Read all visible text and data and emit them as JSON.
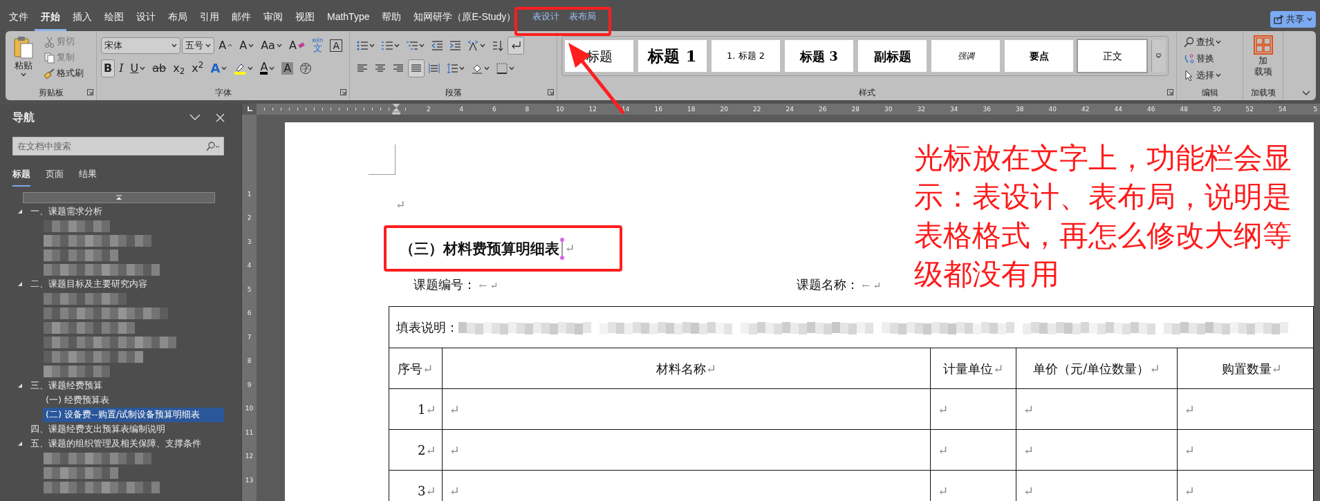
{
  "menu_tabs": [
    {
      "label": "文件",
      "kind": "main",
      "selected": false
    },
    {
      "label": "开始",
      "kind": "main",
      "selected": true
    },
    {
      "label": "插入",
      "kind": "main",
      "selected": false
    },
    {
      "label": "绘图",
      "kind": "main",
      "selected": false
    },
    {
      "label": "设计",
      "kind": "main",
      "selected": false
    },
    {
      "label": "布局",
      "kind": "main",
      "selected": false
    },
    {
      "label": "引用",
      "kind": "main",
      "selected": false
    },
    {
      "label": "邮件",
      "kind": "main",
      "selected": false
    },
    {
      "label": "审阅",
      "kind": "main",
      "selected": false
    },
    {
      "label": "视图",
      "kind": "main",
      "selected": false
    },
    {
      "label": "MathType",
      "kind": "main",
      "selected": false
    },
    {
      "label": "帮助",
      "kind": "main",
      "selected": false
    },
    {
      "label": "知网研学（原E-Study）",
      "kind": "main",
      "selected": false
    },
    {
      "label": "表设计",
      "kind": "context",
      "selected": false
    },
    {
      "label": "表布局",
      "kind": "context",
      "selected": false
    }
  ],
  "share_button": {
    "label": "共享"
  },
  "clipboard": {
    "title": "剪贴板",
    "paste": "粘贴",
    "items": [
      {
        "label": "剪切",
        "disabled": true
      },
      {
        "label": "复制",
        "disabled": true
      },
      {
        "label": "格式刷",
        "disabled": false
      }
    ]
  },
  "font": {
    "title": "字体",
    "font_name": "宋体",
    "font_size": "五号",
    "row1": [
      {
        "glyph": "A"
      },
      {
        "glyph": "A"
      },
      {
        "glyph": "Aa"
      },
      {
        "glyph": "A"
      },
      {
        "ruby": "wén",
        "glyph": "文"
      },
      {
        "glyph": "A"
      }
    ],
    "row2": [
      {
        "glyph": "B",
        "pressed": true
      },
      {
        "glyph": "I",
        "pressed": false
      },
      {
        "glyph": "U",
        "pressed": false
      },
      {
        "glyph": "ab",
        "pressed": false
      },
      {
        "glyph": "x$_{2}$",
        "pressed": false
      },
      {
        "glyph": "x$^{2}$",
        "pressed": false
      },
      {
        "glyph": "A",
        "pressed": false
      },
      {
        "pressed": false
      },
      {
        "glyph": "A",
        "pressed": false
      },
      {
        "glyph": "A",
        "pressed": false
      },
      {
        "glyph": "字",
        "pressed": false
      }
    ]
  },
  "paragraph": {
    "title": "段落",
    "row1": [
      {
        "pressed": false
      },
      {
        "pressed": false
      },
      {
        "pressed": false
      },
      {
        "pressed": false
      },
      {
        "pressed": false
      },
      {
        "pressed": false
      },
      {
        "pressed": false
      },
      {
        "pressed": true
      }
    ],
    "row2": [
      {
        "pressed": false
      },
      {
        "pressed": false
      },
      {
        "pressed": false
      },
      {
        "pressed": true
      },
      {
        "pressed": false
      },
      {
        "pressed": false
      },
      {
        "pressed": false
      },
      {
        "pressed": false
      }
    ]
  },
  "styles": {
    "title": "样式",
    "items": [
      {
        "label": "标题",
        "kind": "title",
        "selected": false
      },
      {
        "label": "标题 1",
        "kind": "heading1",
        "selected": false
      },
      {
        "label": "1. 标题 2",
        "kind": "heading2",
        "selected": false
      },
      {
        "label": "标题 3",
        "kind": "heading3",
        "selected": false
      },
      {
        "label": "副标题",
        "kind": "subtitle",
        "selected": false
      },
      {
        "label": "强调",
        "kind": "emphasis",
        "selected": false
      },
      {
        "label": "要点",
        "kind": "strong",
        "selected": false
      },
      {
        "label": "正文",
        "kind": "normal",
        "selected": true
      }
    ]
  },
  "editing": {
    "title": "编辑",
    "items": [
      {
        "label": "查找"
      },
      {
        "label": "替换"
      },
      {
        "label": "选择"
      }
    ]
  },
  "addins": {
    "title": "加载项",
    "label_lines": [
      "加",
      "载项"
    ]
  },
  "ruler_numbers": [
    "2",
    "4",
    "6",
    "8",
    "10",
    "12",
    "14",
    "16",
    "18",
    "20",
    "22",
    "24",
    "26",
    "28",
    "30",
    "32",
    "34",
    "36",
    "38",
    "40",
    "42",
    "44",
    "46",
    "48",
    "50",
    "52",
    "54",
    "5"
  ],
  "vertical_ruler_numbers": [
    "1",
    "2",
    "3",
    "4",
    "5",
    "6",
    "7",
    "8",
    "9",
    "10",
    "11",
    "12",
    "13"
  ],
  "nav": {
    "title": "导航",
    "search": {
      "placeholder": "在文档中搜索"
    },
    "tabs": [
      {
        "label": "标题",
        "selected": true
      },
      {
        "label": "页面",
        "selected": false
      },
      {
        "label": "结果",
        "selected": false
      }
    ],
    "tree": [
      {
        "kind": "heading",
        "label": "一、课题需求分析",
        "expanded": true,
        "selected": false,
        "children": [
          {
            "kind": "blurred"
          },
          {
            "kind": "blurred"
          },
          {
            "kind": "blurred"
          },
          {
            "kind": "blurred"
          }
        ]
      },
      {
        "kind": "heading",
        "label": "二、课题目标及主要研究内容",
        "expanded": true,
        "selected": false,
        "children": [
          {
            "kind": "blurred"
          },
          {
            "kind": "blurred"
          },
          {
            "kind": "blurred"
          },
          {
            "kind": "blurred"
          },
          {
            "kind": "blurred"
          },
          {
            "kind": "blurred"
          }
        ]
      },
      {
        "kind": "heading",
        "label": "三、课题经费预算",
        "expanded": true,
        "selected": false,
        "children": [
          {
            "kind": "heading",
            "label": "(一) 经费预算表",
            "expanded": false,
            "selected": false
          },
          {
            "kind": "heading",
            "label": "(二) 设备费--购置/试制设备预算明细表",
            "expanded": false,
            "selected": true
          }
        ]
      },
      {
        "kind": "heading",
        "label": "四、课题经费支出预算表编制说明",
        "expanded": false,
        "selected": false
      },
      {
        "kind": "heading",
        "label": "五、课题的组织管理及相关保障、支撑条件",
        "expanded": true,
        "selected": false,
        "children": [
          {
            "kind": "blurred"
          },
          {
            "kind": "blurred"
          },
          {
            "kind": "blurred"
          }
        ]
      }
    ]
  },
  "document": {
    "empty_mark": "↵",
    "heading": {
      "text": "（三）材料费预算明细表",
      "mark": "↵"
    },
    "fields": [
      {
        "label": "课题编号：",
        "mark": "← ↵"
      },
      {
        "label": "课题名称：",
        "mark": "← ↵"
      }
    ],
    "table": {
      "instruction": {
        "label": "填表说明：",
        "blurred": true
      },
      "columns": [
        {
          "label": "序号",
          "mark": "↵"
        },
        {
          "label": "材料名称",
          "mark": "↵"
        },
        {
          "label": "计量单位",
          "mark": "↵"
        },
        {
          "label": "单价（元/单位数量）",
          "mark": "↵"
        },
        {
          "label": "购置数量",
          "mark": "↵"
        }
      ],
      "rows": [
        {
          "cells": [
            {
              "text": "1",
              "mark": "↵"
            },
            {
              "mark": "↵"
            },
            {
              "mark": "↵"
            },
            {
              "mark": "↵"
            },
            {
              "mark": "↵"
            }
          ]
        },
        {
          "cells": [
            {
              "text": "2",
              "mark": "↵"
            },
            {
              "mark": "↵"
            },
            {
              "mark": "↵"
            },
            {
              "mark": "↵"
            },
            {
              "mark": "↵"
            }
          ]
        },
        {
          "cells": [
            {
              "text": "3",
              "mark": "↵"
            },
            {
              "mark": "↵"
            },
            {
              "mark": "↵"
            },
            {
              "mark": "↵"
            },
            {
              "mark": "↵"
            }
          ]
        }
      ]
    }
  },
  "annotation": {
    "text": "光标放在文字上，功能栏会显示：表设计、表布局，说明是表格格式，再怎么修改大纲等级都没有用"
  }
}
